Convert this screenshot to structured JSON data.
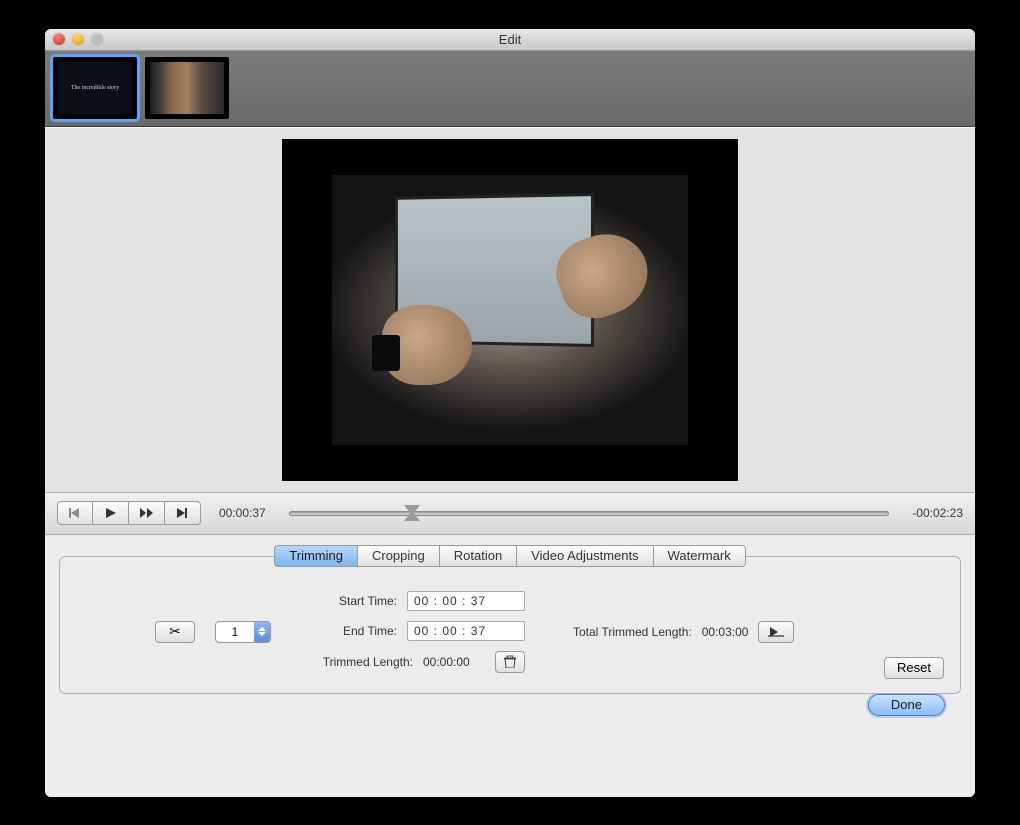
{
  "window": {
    "title": "Edit"
  },
  "thumbnails": {
    "t1_caption": "The incredible story"
  },
  "playback": {
    "current": "00:00:37",
    "remaining": "-00:02:23"
  },
  "tabs": {
    "trimming": "Trimming",
    "cropping": "Cropping",
    "rotation": "Rotation",
    "video_adjustments": "Video Adjustments",
    "watermark": "Watermark"
  },
  "trimming": {
    "segment": "1",
    "start_label": "Start Time:",
    "start_value": "00  :  00  :  37",
    "end_label": "End Time:",
    "end_value": "00  :  00  :  37",
    "trimmed_len_label": "Trimmed Length:",
    "trimmed_len_value": "00:00:00",
    "total_label": "Total Trimmed Length:",
    "total_value": "00:03:00",
    "reset": "Reset"
  },
  "footer": {
    "done": "Done"
  }
}
